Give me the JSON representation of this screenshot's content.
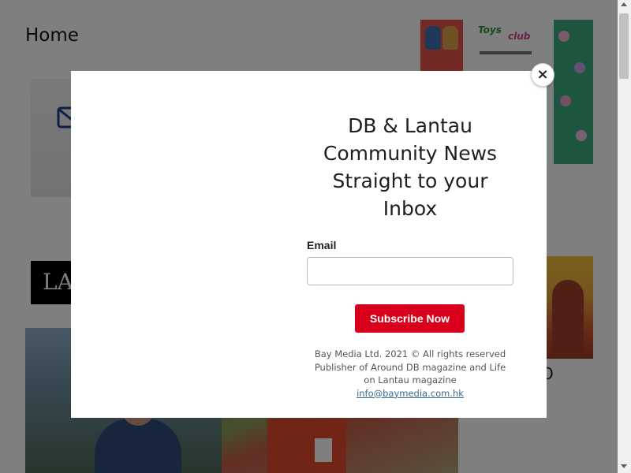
{
  "page": {
    "title": "Home",
    "black_block_text": "LA",
    "right_caption": "O"
  },
  "ads": {
    "ad2_logo_part1": "Toys",
    "ad2_logo_part2": "club"
  },
  "modal": {
    "title": "DB & Lantau Community News Straight to your Inbox",
    "email_label": "Email",
    "email_value": "",
    "email_placeholder": "",
    "subscribe_label": "Subscribe Now",
    "footer_line1": "Bay Media Ltd. 2021 © All rights reserved",
    "footer_line2": "Publisher of Around DB magazine and Life on Lantau magazine",
    "footer_email": "info@baymedia.com.hk",
    "close_label": "×"
  },
  "colors": {
    "subscribe_bg": "#d9001b",
    "overlay": "rgba(0,0,0,0.5)",
    "link": "#3a6a8f"
  },
  "icons": {
    "close": "close-icon",
    "mail": "mail-icon"
  }
}
